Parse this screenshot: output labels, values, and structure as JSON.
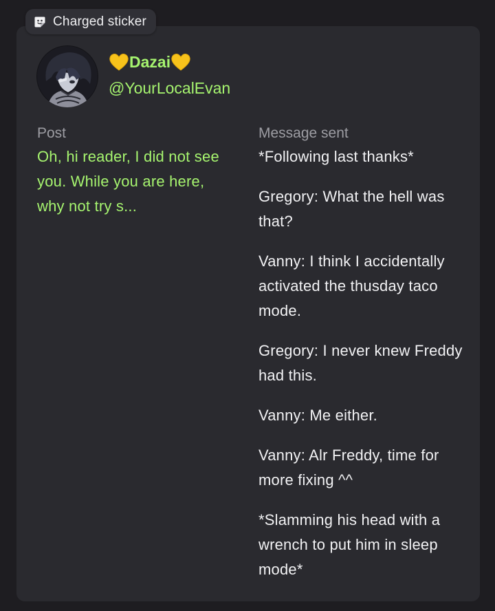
{
  "sticker": {
    "label": "Charged sticker",
    "icon": "sticker-icon"
  },
  "author": {
    "display_name": "Dazai",
    "name_decoration": "yellow-heart-emoji",
    "handle": "@YourLocalEvan",
    "avatar": "avatar-image"
  },
  "post": {
    "label": "Post",
    "text": "Oh, hi reader, I did not see you. While you are here, why not try s..."
  },
  "message": {
    "label": "Message sent",
    "paragraphs": [
      "*Following last thanks*",
      "Gregory: What the hell was that?",
      "Vanny: I think I accidentally activated the thusday taco mode.",
      "Gregory: I never knew Freddy had this.",
      "Vanny: Me either.",
      "Vanny: Alr Freddy, time for more fixing ^^",
      "*Slamming his head with a wrench to put him in sleep mode*"
    ]
  },
  "colors": {
    "background": "#1e1d21",
    "card": "#2a2a2f",
    "accent_green": "#a6f46f",
    "muted_label": "#9d9da3",
    "heart_yellow": "#f7c21b"
  }
}
